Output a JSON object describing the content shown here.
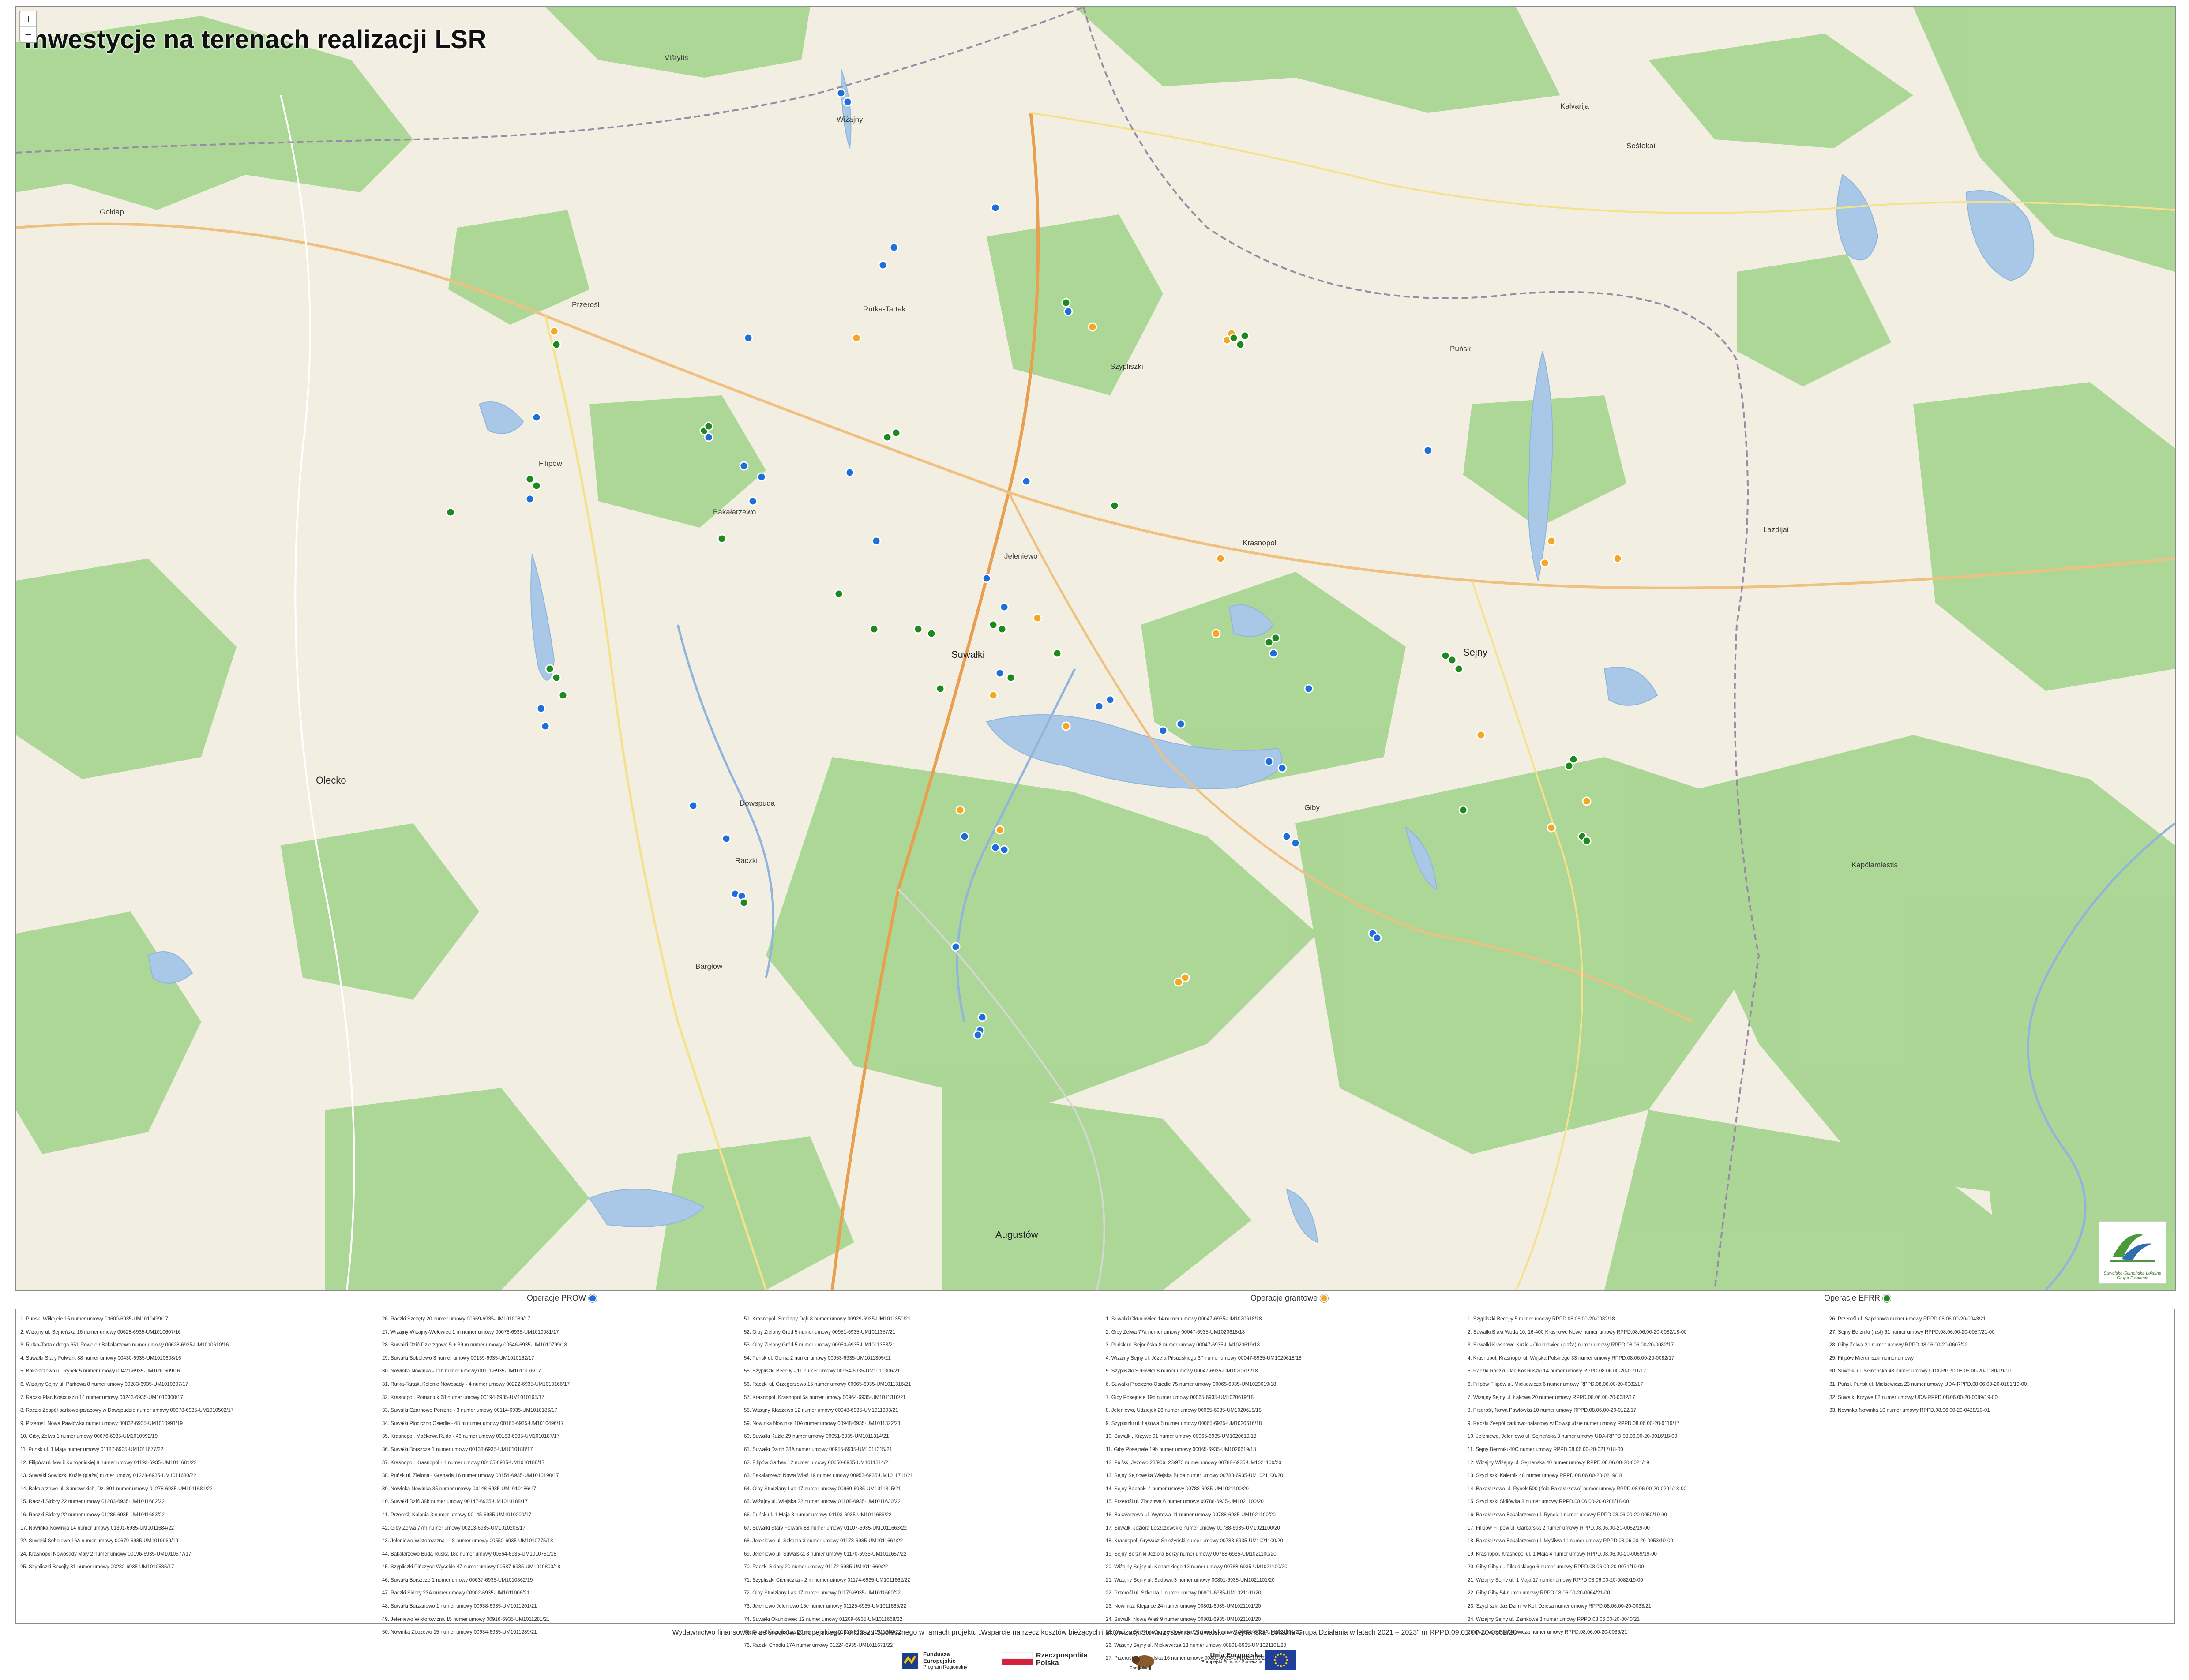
{
  "map": {
    "title": "Inwestycje na terenach realizacji LSR",
    "zoom_in": "+",
    "zoom_out": "−",
    "places": [
      {
        "name": "Suwałki",
        "big": true
      },
      {
        "name": "Sejny",
        "big": true
      },
      {
        "name": "Augustów",
        "big": true
      },
      {
        "name": "Olecko",
        "big": true
      },
      {
        "name": "Gołdap",
        "big": false
      },
      {
        "name": "Filipów",
        "big": false
      },
      {
        "name": "Bakałarzewo",
        "big": false
      },
      {
        "name": "Raczki",
        "big": false
      },
      {
        "name": "Szypliszki",
        "big": false
      },
      {
        "name": "Puńsk",
        "big": false
      },
      {
        "name": "Krasnopol",
        "big": false
      },
      {
        "name": "Giby",
        "big": false
      },
      {
        "name": "Wiżajny",
        "big": false
      },
      {
        "name": "Rutka-Tartak",
        "big": false
      },
      {
        "name": "Jeleniewo",
        "big": false
      },
      {
        "name": "Przerośl",
        "big": false
      },
      {
        "name": "Kalvarija",
        "big": false
      },
      {
        "name": "Lazdijai",
        "big": false
      },
      {
        "name": "Vištytis",
        "big": false
      },
      {
        "name": "Dowspuda",
        "big": false
      },
      {
        "name": "Bargłów",
        "big": false
      },
      {
        "name": "Kapčiamiestis",
        "big": false
      },
      {
        "name": "Šeštokai",
        "big": false
      }
    ],
    "logo_text": "Suwalsko-Sejneńska Lokalna Grupa Działania"
  },
  "legend": {
    "prow_label": "Operacje PROW",
    "grant_label": "Operacje grantowe",
    "efrr_label": "Operacje EFRR",
    "colors": {
      "prow": "#1e6fd9",
      "grant": "#f5a623",
      "efrr": "#1d8a1d"
    }
  },
  "list": {
    "columns": [
      [
        "1. Puńsk, Wiłkojcie 15 numer umowy 00600-6935-UM1010499/17",
        "2. Wiżajny ul. Sejneńska 16 numer umowy 00628-6935-UM1010607/16",
        "3. Rutka-Tartak droga 651 Rowele / Bakałarzewo numer umowy 00628-6935-UM1010610/16",
        "4. Suwałki Stary Folwark 88 numer umowy 00430-6935-UM1010608/16",
        "5. Bakałarzewo ul. Rynek 5 numer umowy 00421-6935-UM1010609/16",
        "6. Wiżajny Sejny ul. Parkowa 8 numer umowy 00283-6935-UM1010307/17",
        "7. Raczki Plac Kościuszki 14 numer umowy 00243-6935-UM1010300/17",
        "8. Raczki Zespół parkowo-pałacowy w Dowspudzie numer umowy 00078-6935-UM1010502/17",
        "9. Przerośl, Nowa Pawłówka numer umowy 00832-6935-UM1010991/19",
        "10. Giby, Zelwa 1 numer umowy 00676-6935-UM1010992/19",
        "11. Puńsk ul. 1 Maja numer umowy 01187-6935-UM1011677/22",
        "12. Filipów ul. Mariii Konopnickiej 8 numer umowy 01193-6935-UM1011681/22",
        "13. Suwałki Sowiczki Kuźle (plaża) numer umowy 01228-6935-UM1011680/22",
        "14. Bakałarzewo ul. Sumowskich, Dz. 891 numer umowy 01278-6935-UM1011681/22",
        "15. Raczki Sidory 22 numer umowy 01283-6935-UM1011682/22",
        "16. Raczki Sidory 22 numer umowy 01286-6935-UM1011683/22",
        "17. Nowinka Nowinka 14 numer umowy 01301-6935-UM1011684/22",
        "22. Suwałki Sobolewo 16A numer umowy 00679-6935-UM1010969/19",
        "24. Krasnopol Nowosady Mały 2 numer umowy 00196-6935-UM1010577/17",
        "25. Szypliszki Becejły 31 numer umowy 00282-6935-UM1010585/17"
      ],
      [
        "26. Raczki Szczęty 20 numer umowy 00669-6935-UM1010089/17",
        "27. Wiżajny Wiżajny-Wołowiec 1 m numer umowy 00078-6935-UM1010081/17",
        "28. Suwałki Dziń Dzierzgowo 5 + 39 m numer umowy 00546-6935-UM1010799/18",
        "29. Suwałki Sobolewo 3 numer umowy 00139-6935-UM1010162/17",
        "30. Nowinka Nowinka - 11b numer umowy 00111-6935-UM1010176/17",
        "31. Rutka-Tartak, Kolonie Nowosady - 4 numer umowy 00222-6935-UM1010166/17",
        "32. Krasnopol, Romaniuk 68 numer umowy 00194-6935-UM1010165/17",
        "33. Suwałki Czarnowo Poniżne - 3 numer umowy 00114-6935-UM1010186/17",
        "34. Suwałki Płociczno Osiedle - 48 m numer umowy 00165-6935-UM1010496/17",
        "35. Krasnopol, Maćkowa Ruda - 46 numer umowy 00183-6935-UM1010187/17",
        "36. Suwałki Borszcze 1 numer umowy 00138-6935-UM1010188/17",
        "37. Krasnopol, Krasnopol - 1 numer umowy 00165-6935-UM1010188/17",
        "38. Puńsk ul. Zielona - Grenada 16 numer umowy 00154-6935-UM1010190/17",
        "39. Nowinka Nowinka 35 numer umowy 00148-6935-UM1010186/17",
        "40. Suwałki Dziń 38b numer umowy 00147-6935-UM1010188/17",
        "41. Przerośl, Kolonia 3 numer umowy 00145-6935-UM1010200/17",
        "42. Giby Zelwa 77m numer umowy 00213-6935-UM1010206/17",
        "43. Jeleniewo Wiktorowizna - 18 numer umowy 00552-6935-UM1010775/18",
        "44. Bakałarzewo Buda Ruska 18c numer umowy 00564-6935-UM1010751/18",
        "45. Szypliszki Pińczyce Wysokie 47 numer umowy 00587-6935-UM1010800/18",
        "46. Suwałki Borszcze 1 numer umowy 00637-6935-UM1010862/19",
        "47. Raczki Sidory 23A numer umowy 00902-6935-UM1011006/21",
        "48. Suwałki Burzanowo 1 numer umowy 00938-6935-UM1011201/21",
        "49. Jeleniewo Wiktorowizna 15 numer umowy 00916-6935-UM1011281/21",
        "50. Nowinka Zbożewo 15 numer umowy 00934-6935-UM1011289/21"
      ],
      [
        "51. Krasnopol, Smolany Dąb 8 numer umowy 00929-6935-UM1011350/21",
        "52. Giby Zielony Gród 5 numer umowy 00951-6935-UM1011357/21",
        "53. Giby Zielony Gród 5 numer umowy 00950-6935-UM1011358/21",
        "54. Puńsk ul. Górna 2 numer umowy 00953-6935-UM1011305/21",
        "55. Szypliszki Becejły - 11 numer umowy 00954-6935-UM1011306/21",
        "56. Raczki ul. Grzegorzewo 15 numer umowy 00965-6935-UM1011316/21",
        "57. Krasnopol, Krasnopol 5a numer umowy 00964-6935-UM1011310/21",
        "58. Wiżajny Kłaszewo 12 numer umowy 00948-6935-UM1011303/21",
        "59. Nowinka Nowinka 10A numer umowy 00948-6935-UM1011322/21",
        "60. Suwałki Kuźle 29 numer umowy 00951-6935-UM1011314/21",
        "61. Suwałki Dzińń 38A numer umowy 00955-6935-UM1011315/21",
        "62. Filipów Garbas 12 numer umowy 00650-6935-UM1011314/21",
        "63. Bakałarzewo Nowa Wieś 19 numer umowy 00953-6935-UM1011711/21",
        "64. Giby Studziany Las 17 numer umowy 00969-6935-UM1011315/21",
        "65. Wiżajny ul. Wiejska 22 numer umowy 01108-6935-UM1011630/22",
        "66. Puńsk ul. 1 Maja 8 numer umowy 01193-6935-UM1011686/22",
        "67. Suwałki Stary Folwark 88 numer umowy 01107-6935-UM1011663/22",
        "68. Jeleniewo ul. Szkolna 3 numer umowy 01178-6935-UM1011664/22",
        "69. Jeleniewo ul. Suwalska 8 numer umowy 01170-6935-UM1011657/22",
        "70. Raczki Sidory 20 numer umowy 01172-6935-UM1011660/22",
        "71. Szypliszki Cierniczka - 2 m numer umowy 01174-6935-UM1011662/22",
        "72. Giby Studziany Las 17 numer umowy 01179-6935-UM1011660/22",
        "73. Jeleniewo Jeleniewo 15e numer umowy 01125-6935-UM1011665/22",
        "74. Suwałki Okuniowiec 12 numer umowy 01209-6935-UM1011668/22",
        "75. Giby Studziany Las 20 numer umowy 01213-6935-UM1011669/22",
        "76. Raczki Chodki 17A numer umowy 01224-6935-UM1011671/22"
      ],
      [
        "1. Suwałki Okuniowiec 14 numer umowy 00047-6935-UM1020618/18",
        "2. Giby Zelwa 77a numer umowy 00047-6935-UM1020618/18",
        "3. Puńsk ul. Sejneńska 8 numer umowy 00047-6935-UM1020619/18",
        "4. Wiżajny Sejny ul. Józefa Piłsudskiego 37 numer umowy 00047-6935-UM1020618/18",
        "5. Szypliszki Sidłówka 8 numer umowy 00047-6935-UM1020619/18",
        "6. Suwałki Płociczno-Osiedle 75 numer umowy 00065-6935-UM1020619/18",
        "7. Giby Posejnele 19b numer umowy 00065-6935-UM1020619/18",
        "8. Jeleniewo, Udziejek 26 numer umowy 00065-6935-UM1020618/18",
        "9. Szypliszki ul. Łąkowa 5 numer umowy 00065-6935-UM1020616/18",
        "10. Suwałki, Krzywe 91 numer umowy 00065-6935-UM1020619/18",
        "11. Giby Posejnele 19b numer umowy 00065-6935-UM1020619/18",
        "12. Puńsk, Jeżowo 23/906, 23/973 numer umowy 00788-6935-UM1021100/20",
        "13. Sejny Sejnowska Wiejska Buda numer umowy 00788-6935-UM1021100/20",
        "14. Sejny Babanki 4 numer umowy 00788-6935-UM1021100/20",
        "15. Przerośl ul. Zbożowa 6 numer umowy 00788-6935-UM1021100/20",
        "16. Bakałarzewo ul. Wyrtowa 11 numer umowy 00788-6935-UM1021100/20",
        "17. Suwałki Jeziora Leszczewskie numer umowy 00788-6935-UM1021100/20",
        "18. Krasnopol, Grywacz Śnieżyński numer umowy 00788-6935-UM1021100/20",
        "19. Sejny Berżniki Jeziora Berży numer umowy 00788-6935-UM1021100/20",
        "20. Wiżajny Sejny ul. Konarskiego 13 numer umowy 00788-6935-UM1021100/20",
        "21. Wiżajny Sejny ul. Sadowa 3 numer umowy 00801-6935-UM1021101/20",
        "22. Przerośl ul. Szkolna 1 numer umowy 00801-6935-UM1021101/20",
        "23. Nowinka, Klejańce 24 numer umowy 00801-6935-UM1021101/20",
        "24. Suwałki Nowa Wieś 9 numer umowy 00801-6935-UM1021101/20",
        "25. Wiżajny Sejny ul. Drogie Kłodnickiego 1 numer umowy 00801-6935-UM1021101/20",
        "26. Wiżajny Sejny ul. Mickiewicza 13 numer umowy 00801-6935-UM1021101/20",
        "27. Przerośl ul. Suwalska 16 numer umowy 00801-6935-UM1021101/20"
      ],
      [
        "1. Szypliszki Becejły 5 numer umowy RPPD.08.06.00-20-0082/18",
        "2. Suwałki Biała Woda 10, 16-400 Krasnowe Nowe numer umowy RPPD.08.06.00-20-0082/18-00",
        "3. Suwałki Krasnowe Kuźle - Okuniowiec (plaża) numer umowy RPPD.08.06.00-20-0082/17",
        "4. Krasnopol, Krasnopol ul. Wojska Polskiego 33 numer umowy RPPD.08.06.00-20-0082/17",
        "5. Raczki Raczki Plac Kościuszki 14 numer umowy RPPD.08.06.00-20-0091/17",
        "6. Filipów Filipów ul. Mickiewicza 6 numer umowy RPPD.08.06.00-20-0082/17",
        "7. Wiżajny Sejny ul. Łąkowa 20 numer umowy RPPD.08.06.00-20-0082/17",
        "8. Przerośl, Nowa Pawłówka 10 numer umowy RPPD.08.06.00-20-0122/17",
        "9. Raczki Zespół parkowo-pałacowy w Dowspudzie numer umowy RPPD.08.06.00-20-0119/17",
        "10. Jeleniewo, Jeleniewo ul. Sejneńska 3 numer umowy UDA-RPPD.08.06.00-20-0016/18-00",
        "11. Sejny Berżniki 40C numer umowy RPPD.08.06.00-20-0217/18-00",
        "12. Wiżajny Wiżajny ul. Sejneńska 40 numer umowy RPPD.08.06.00-20-0021/19",
        "13. Szypliszki Kaletnik 48 numer umowy RPPD.08.06.00-20-0219/18",
        "14. Bakałarzewo ul. Rynek 500 (ścia Bakałarzewo) numer umowy RPPD.08.06.00-20-0291/18-00",
        "15. Szypliszki Sidłówka 8 numer umowy RPPD.08.06.00-20-0288/18-00",
        "16. Bakałarzewo Bakałarzewo ul. Rynek 1 numer umowy RPPD.08.06.00-20-0050/19-00",
        "17. Filipów Filipów ul. Garbarska 2 numer umowy RPPD.08.06.00-20-0052/19-00",
        "18. Bakałarzewo Bakałarzewo ul. Myśliwa 11 numer umowy RPPD.08.06.00-20-0053/19-00",
        "19. Krasnopol, Krasnopol ul. 1 Maja 4 numer umowy RPPD.08.06.00-20-0069/19-00",
        "20. Giby Giby ul. Piłsudskiego 6 numer umowy RPPD.08.06.00-20-0071/19-00",
        "21. Wiżajny Sejny ul. 1 Maja 17 numer umowy RPPD.08.06.00-20-0082/19-00",
        "22. Giby Giby 54 numer umowy RPPD.08.06.00-20-0064/21-00",
        "23. Szypliszki Jaz Dzimi w Kol. Dziesa numer umowy RPPD.08.06.00-20-0033/21",
        "24. Wiżajny Sejny ul. Zamkowa 3 numer umowy RPPD.08.06.00-20-0040/21",
        "25. Przerośl ul. Mickiewicza numer umowy RPPD.08.06.00-20-0036/21"
      ],
      [
        "26. Przerośl ul. Sapanowa numer umowy RPPD.08.06.00-20-0043/21",
        "27. Sejny Berżniki (n.st) 61 numer umowy RPPD.08.06.00-20-0057/21-00",
        "28. Giby Zelwa 21 numer umowy RPPD.08.06.00-20-0607/22",
        "29. Filipów Mieruniszki numer umowy",
        "30. Suwałki ul. Sejneńska 43 numer umowy UDA-RPPD.08.06.00-20-0180/19-00",
        "31. Puńsk Puńsk ul. Mickiewicza 23 numer umowy UDA-RPPD.08.06.00-20-0181/19-00",
        "32. Suwałki Krzywe 82 numer umowy UDA-RPPD.08.06.00-20-0089/19-00",
        "33. Nowinka Nowinka 10 numer umowy RPPD.08.06.00-20-0428/20-01"
      ]
    ]
  },
  "footer": {
    "text": "Wydawnictwo finansowane ze środków Europejskiego Funduszu Społecznego w ramach projektu „Wsparcie na rzecz kosztów bieżących i aktywizacji Stowarzyszenia \"Suwalsko – Sejneńska\" Lokalna Grupa Działania w latach 2021 – 2023\" nr RPPD.09.01.00-20-0562/20",
    "fe_line1": "Fundusze",
    "fe_line2": "Europejskie",
    "fe_line3": "Program Regionalny",
    "rp_line1": "Rzeczpospolita",
    "rp_line2": "Polska",
    "ue_line1": "Unia Europejska",
    "ue_line2": "Europejski Fundusz Społeczny",
    "pd_label": "Podlaskie"
  }
}
